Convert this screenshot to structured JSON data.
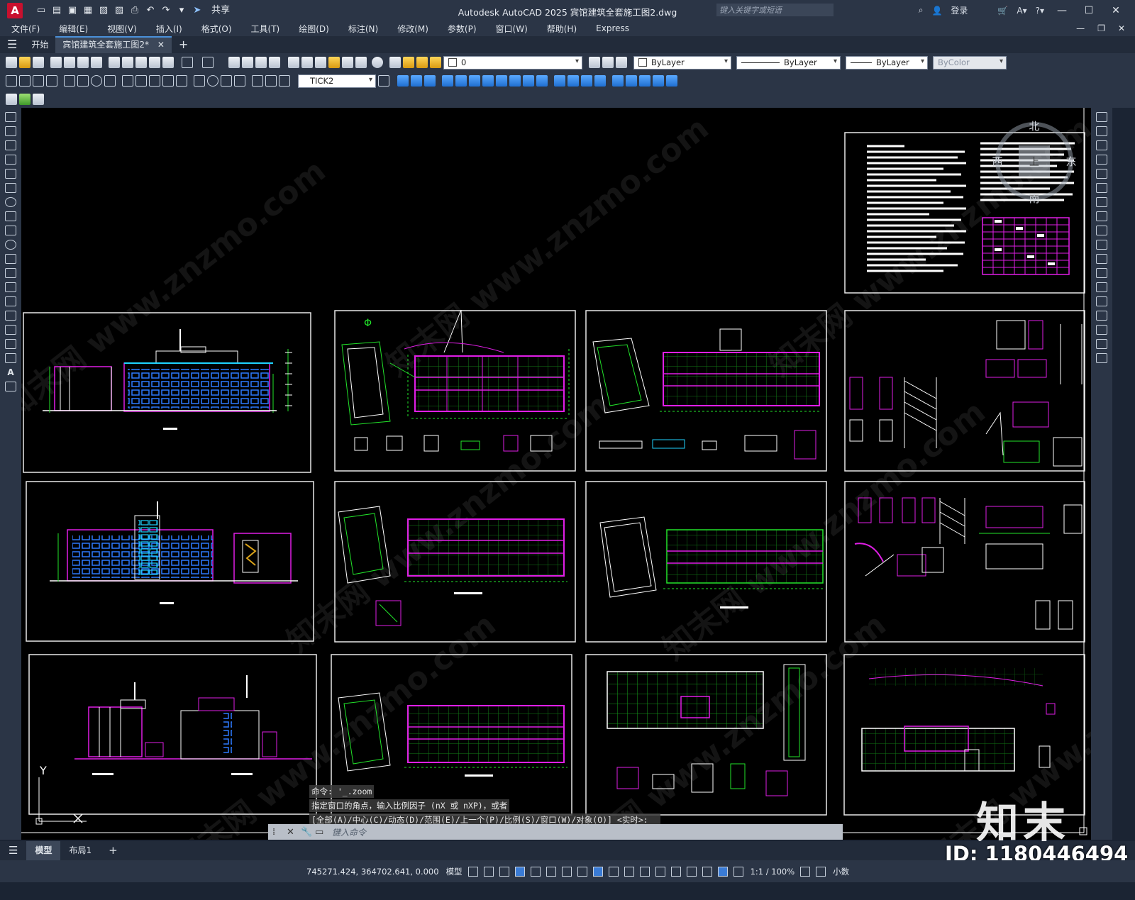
{
  "app": {
    "logo_letter": "A",
    "window_title": "Autodesk AutoCAD 2025    宾馆建筑全套施工图2.dwg",
    "share_label": "共享",
    "search_placeholder": "键入关键字或短语",
    "login_label": "登录"
  },
  "menu": [
    "文件(F)",
    "编辑(E)",
    "视图(V)",
    "插入(I)",
    "格式(O)",
    "工具(T)",
    "绘图(D)",
    "标注(N)",
    "修改(M)",
    "参数(P)",
    "窗口(W)",
    "帮助(H)",
    "Express"
  ],
  "tabs": {
    "start": "开始",
    "active_doc": "宾馆建筑全套施工图2*"
  },
  "toolbar": {
    "layer_value": "0",
    "dimstyle_value": "TICK2",
    "color_value": "ByLayer",
    "linetype_value": "ByLayer",
    "lineweight_value": "ByLayer",
    "plotstyle_value": "ByColor"
  },
  "compass": {
    "north": "北",
    "east": "东",
    "west": "西",
    "south": "南",
    "top": "上"
  },
  "ucs": {
    "y": "Y"
  },
  "command": {
    "history": [
      "命令: '_.zoom",
      "指定窗口的角点，输入比例因子 (nX 或 nXP)，或者",
      "[全部(A)/中心(C)/动态(D)/范围(E)/上一个(P)/比例(S)/窗口(W)/对象(O)] <实时>: _e"
    ],
    "input_placeholder": "键入命令"
  },
  "layout_tabs": [
    "模型",
    "布局1"
  ],
  "status": {
    "coordinates": "745271.424, 364702.641, 0.000",
    "space": "模型",
    "scale": "1:1 / 100%",
    "units": "小数"
  },
  "watermark": {
    "logo": "知末",
    "id": "ID: 1180446494",
    "diagonal_text": "知末网 www.znzmo.com"
  },
  "colors": {
    "canvas_bg": "#000000",
    "ui_bg": "#2b3546",
    "green": "#22e32a",
    "magenta": "#e01ee6",
    "cyan": "#1fd3ff",
    "white": "#ffffff",
    "blue": "#2d5bff"
  }
}
